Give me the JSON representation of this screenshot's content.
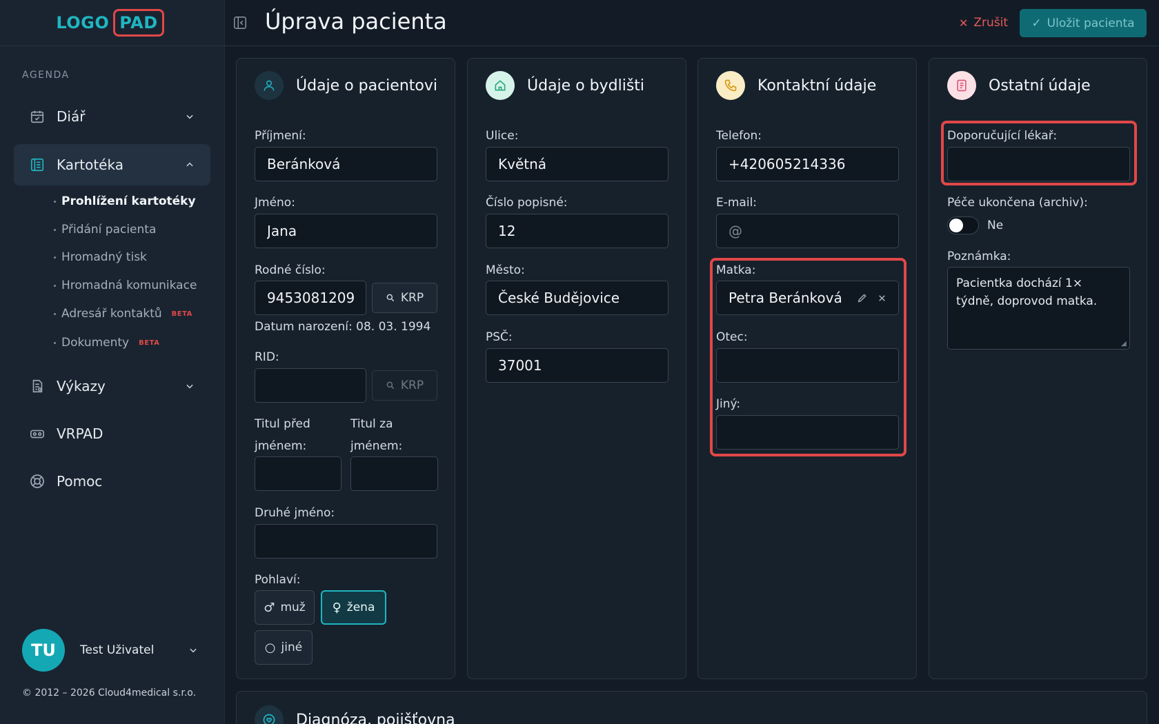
{
  "sidebar": {
    "logo": {
      "part_a": "LOGO",
      "part_b": "PAD"
    },
    "section_label": "AGENDA",
    "items": [
      {
        "label": "Diář",
        "icon": "calendar-icon",
        "expanded": false
      },
      {
        "label": "Kartotéka",
        "icon": "card-file-icon",
        "expanded": true,
        "active": true
      },
      {
        "label": "Výkazy",
        "icon": "report-icon",
        "expanded": false
      },
      {
        "label": "VRPAD",
        "icon": "vr-icon"
      },
      {
        "label": "Pomoc",
        "icon": "lifebuoy-icon"
      }
    ],
    "subitems": [
      {
        "label": "Prohlížení kartotéky",
        "active": true
      },
      {
        "label": "Přidání pacienta"
      },
      {
        "label": "Hromadný tisk"
      },
      {
        "label": "Hromadná komunikace"
      },
      {
        "label": "Adresář kontaktů",
        "badge": "BETA"
      },
      {
        "label": "Dokumenty",
        "badge": "BETA"
      }
    ],
    "user": {
      "initials": "TU",
      "name": "Test Uživatel"
    },
    "copyright": "© 2012 – 2026 Cloud4medical s.r.o."
  },
  "header": {
    "title": "Úprava pacienta",
    "cancel_label": "Zrušit",
    "save_label": "Uložit pacienta"
  },
  "patient": {
    "title": "Údaje o pacientovi",
    "surname_label": "Příjmení:",
    "surname": "Beránková",
    "name_label": "Jméno:",
    "name": "Jana",
    "birth_number_label": "Rodné číslo:",
    "birth_number": "9453081209",
    "krp_label": "KRP",
    "birth_date_text": "Datum narození: 08. 03. 1994",
    "rid_label": "RID:",
    "rid": "",
    "title_before_label_1": "Titul před",
    "title_before_label_2": "jménem:",
    "title_after_label_1": "Titul za",
    "title_after_label_2": "jménem:",
    "middle_name_label": "Druhé jméno:",
    "gender_label": "Pohlaví:",
    "gender_options": [
      "muž",
      "žena",
      "jiné"
    ],
    "gender_selected": "žena"
  },
  "residence": {
    "title": "Údaje o bydlišti",
    "street_label": "Ulice:",
    "street": "Květná",
    "house_number_label": "Číslo popisné:",
    "house_number": "12",
    "city_label": "Město:",
    "city": "České Budějovice",
    "zip_label": "PSČ:",
    "zip": "37001"
  },
  "contact": {
    "title": "Kontaktní údaje",
    "phone_label": "Telefon:",
    "phone": "+420605214336",
    "email_label": "E-mail:",
    "email_placeholder": "@",
    "mother_label": "Matka:",
    "mother": "Petra Beránková",
    "father_label": "Otec:",
    "other_label": "Jiný:"
  },
  "other": {
    "title": "Ostatní údaje",
    "referring_doctor_label": "Doporučující lékař:",
    "archive_label": "Péče ukončena (archiv):",
    "archive_value": "Ne",
    "archive_on": false,
    "note_label": "Poznámka:",
    "note": "Pacientka dochází 1× týdně, doprovod matka."
  },
  "bottom_section": {
    "title": "Diagnóza, pojišťovna"
  },
  "colors": {
    "accent": "#1fb6c1",
    "highlight": "#e04848",
    "cancel": "#e65a5a",
    "save_bg": "#0e6b74"
  }
}
